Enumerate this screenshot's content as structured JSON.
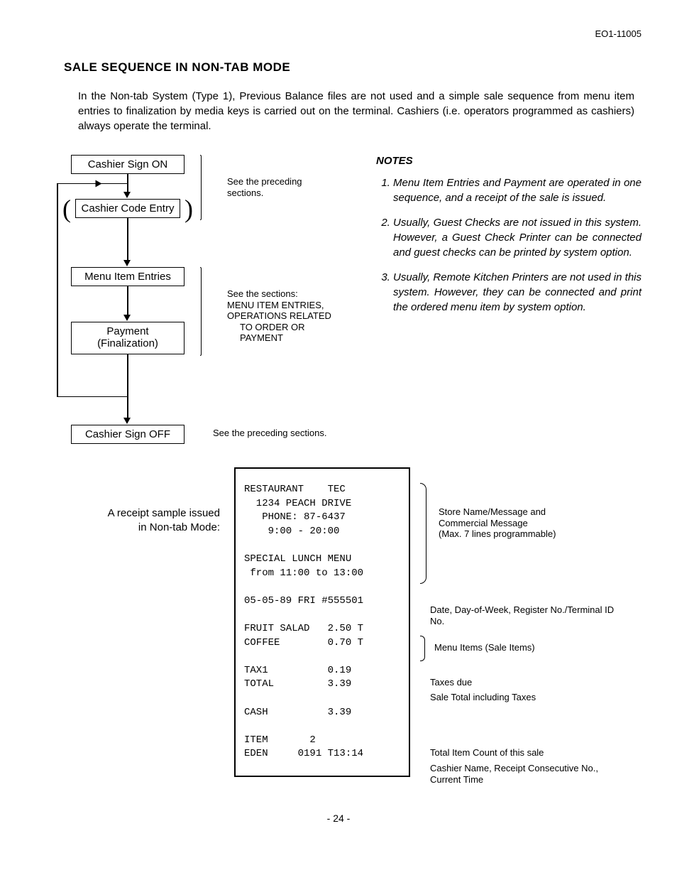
{
  "doc_id": "EO1-11005",
  "title": "SALE SEQUENCE IN NON-TAB MODE",
  "intro": "In the Non-tab System (Type 1), Previous Balance files are not used and a simple sale sequence from menu item entries to finalization by media keys is carried out on the terminal. Cashiers (i.e. operators programmed as cashiers) always operate the terminal.",
  "flow": {
    "step1": "Cashier Sign ON",
    "step2": "Cashier Code Entry",
    "step3": "Menu Item Entries",
    "step4_a": "Payment",
    "step4_b": "(Finalization)",
    "step5": "Cashier Sign OFF"
  },
  "annot": {
    "a1_l1": "See the preceding",
    "a1_l2": "sections.",
    "a2_l1": "See the sections:",
    "a2_l2": "MENU ITEM ENTRIES,",
    "a2_l3": "OPERATIONS RELATED",
    "a2_l4": "TO ORDER OR",
    "a2_l5": "PAYMENT",
    "a3": "See the preceding sections."
  },
  "notes_title": "NOTES",
  "notes": {
    "n1": "Menu Item Entries and Payment are operated in one sequence, and a receipt of the sale is issued.",
    "n2": "Usually, Guest Checks are not issued in this system. However, a Guest Check Printer can be connected and guest checks can be printed by system option.",
    "n3": "Usually, Remote Kitchen Printers are not used in this system. However, they can be connected and print the ordered menu item by system option."
  },
  "receipt_label_l1": "A receipt sample issued",
  "receipt_label_l2": "in Non-tab Mode:",
  "receipt": {
    "l1": "RESTAURANT    TEC",
    "l2": "  1234 PEACH DRIVE",
    "l3": "   PHONE: 87-6437",
    "l4": "    9:00 - 20:00",
    "l5": "",
    "l6": "SPECIAL LUNCH MENU",
    "l7": " from 11:00 to 13:00",
    "l8": "",
    "l9": "05-05-89 FRI #555501",
    "l10": "",
    "l11": "FRUIT SALAD   2.50 T",
    "l12": "COFFEE        0.70 T",
    "l13": "",
    "l14": "TAX1          0.19",
    "l15": "TOTAL         3.39",
    "l16": "",
    "l17": "CASH          3.39",
    "l18": "",
    "l19": "ITEM       2",
    "l20": "EDEN     0191 T13:14"
  },
  "rannot": {
    "r1_l1": "Store Name/Message and",
    "r1_l2": "Commercial Message",
    "r1_l3": "(Max. 7 lines programmable)",
    "r2": "Date, Day-of-Week, Register No./Terminal ID No.",
    "r3": "Menu Items (Sale Items)",
    "r4": "Taxes due",
    "r5": "Sale Total including Taxes",
    "r6": "Total Item Count of this sale",
    "r7": "Cashier Name, Receipt Consecutive No., Current Time"
  },
  "page_num": "- 24 -"
}
